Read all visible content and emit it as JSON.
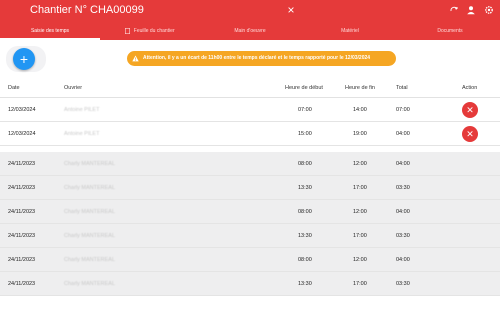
{
  "header": {
    "title": "Chantier N° CHA00099",
    "close_symbol": "×"
  },
  "tabs": [
    {
      "label": "Saisie des temps"
    },
    {
      "label": "Feuille du chantier"
    },
    {
      "label": "Main d'oeuvre"
    },
    {
      "label": "Matériel"
    },
    {
      "label": "Documents"
    }
  ],
  "add_button": {
    "symbol": "+"
  },
  "warning": {
    "text": "Attention, il y a un écart de 11h00 entre le temps déclaré et le temps rapporté pour le 12/03/2024"
  },
  "table": {
    "columns": {
      "date": "Date",
      "worker": "Ouvrier",
      "start": "Heure de début",
      "end": "Heure de fin",
      "total": "Total",
      "action": "Action"
    },
    "rows": [
      {
        "date": "12/03/2024",
        "worker": "Antoine PILET",
        "start": "07:00",
        "end": "14:00",
        "total": "07:00",
        "deletable": true
      },
      {
        "date": "12/03/2024",
        "worker": "Antoine PILET",
        "start": "15:00",
        "end": "19:00",
        "total": "04:00",
        "deletable": true
      },
      {
        "date": "24/11/2023",
        "worker": "Charly MANTEREAL",
        "start": "08:00",
        "end": "12:00",
        "total": "04:00",
        "deletable": false
      },
      {
        "date": "24/11/2023",
        "worker": "Charly MANTEREAL",
        "start": "13:30",
        "end": "17:00",
        "total": "03:30",
        "deletable": false
      },
      {
        "date": "24/11/2023",
        "worker": "Charly MANTEREAL",
        "start": "08:00",
        "end": "12:00",
        "total": "04:00",
        "deletable": false
      },
      {
        "date": "24/11/2023",
        "worker": "Charly MANTEREAL",
        "start": "13:30",
        "end": "17:00",
        "total": "03:30",
        "deletable": false
      },
      {
        "date": "24/11/2023",
        "worker": "Charly MANTEREAL",
        "start": "08:00",
        "end": "12:00",
        "total": "04:00",
        "deletable": false
      },
      {
        "date": "24/11/2023",
        "worker": "Charly MANTEREAL",
        "start": "13:30",
        "end": "17:00",
        "total": "03:30",
        "deletable": false
      }
    ]
  },
  "icons": {
    "header_right": [
      "sync-icon",
      "account-icon",
      "settings-icon"
    ],
    "tab": "document-icon",
    "warning": "warning-icon",
    "row_action": "close-icon"
  },
  "colors": {
    "primary": "#e53a3a",
    "accent_blue": "#2196f3",
    "warning": "#f5a623"
  }
}
